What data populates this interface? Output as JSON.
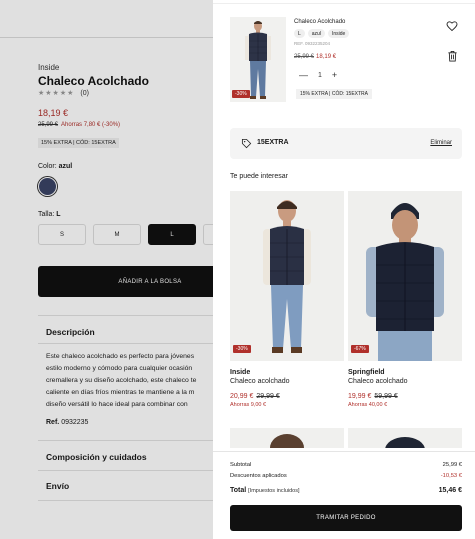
{
  "product": {
    "brand": "Inside",
    "title": "Chaleco Acolchado",
    "stars": "★★★★★",
    "rating_count": "(0)",
    "price": "18,19 €",
    "old_price": "25,99 €",
    "savings": "Ahorras 7,80 € (-30%)",
    "promo": "15% EXTRA | CÓD: 15EXTRA",
    "color_label": "Color:",
    "color_value": "azul",
    "size_label": "Talla:",
    "size_value": "L",
    "sizes": [
      "S",
      "M",
      "L",
      ""
    ],
    "add_to_bag": "AÑADIR A LA BOLSA",
    "description_heading": "Descripción",
    "description_lines": [
      "Este chaleco acolchado es perfecto para jóvenes",
      "estilo moderno y cómodo para cualquier ocasión",
      "cremallera y su diseño acolchado, este chaleco te",
      "caliente en días fríos mientras te mantiene a la m",
      "diseño versátil lo hace ideal para combinar con"
    ],
    "ref_label": "Ref.",
    "ref_value": "0932235",
    "composition_heading": "Composición y cuidados",
    "shipping_heading": "Envío"
  },
  "cart": {
    "item": {
      "name": "Chaleco Acolchado",
      "chips": [
        "L",
        "azul",
        "Inside"
      ],
      "ref": "REF. 0932235204",
      "old_price": "25,99 €",
      "price": "18,19 €",
      "minus": "—",
      "quantity": "1",
      "plus": "+",
      "promo": "15% EXTRA | CÓD: 15EXTRA",
      "badge": "-30%"
    },
    "coupon": {
      "code": "15EXTRA",
      "remove_label": "Eliminar"
    },
    "suggestions_heading": "Te puede interesar",
    "suggestions": [
      {
        "brand": "Inside",
        "name": "Chaleco acolchado",
        "price": "20,99 €",
        "old_price": "29,99 €",
        "savings": "Ahorras 9,00 €",
        "badge": "-30%"
      },
      {
        "brand": "Springfield",
        "name": "Chaleco acolchado",
        "price": "19,99 €",
        "old_price": "59,99 €",
        "savings": "Ahorras 40,00 €",
        "badge": "-67%"
      }
    ],
    "summary": {
      "subtotal_label": "Subtotal",
      "subtotal_value": "25,99 €",
      "discounts_label": "Descuentos aplicados",
      "discounts_value": "-10,53 €",
      "total_label": "Total",
      "total_note": "[Impuestos incluidos]",
      "total_value": "15,46 €"
    },
    "checkout_label": "TRAMITAR PEDIDO"
  },
  "colors": {
    "accent_red": "#b0302b",
    "dark": "#111111",
    "swatch_navy": "#3b4466"
  }
}
